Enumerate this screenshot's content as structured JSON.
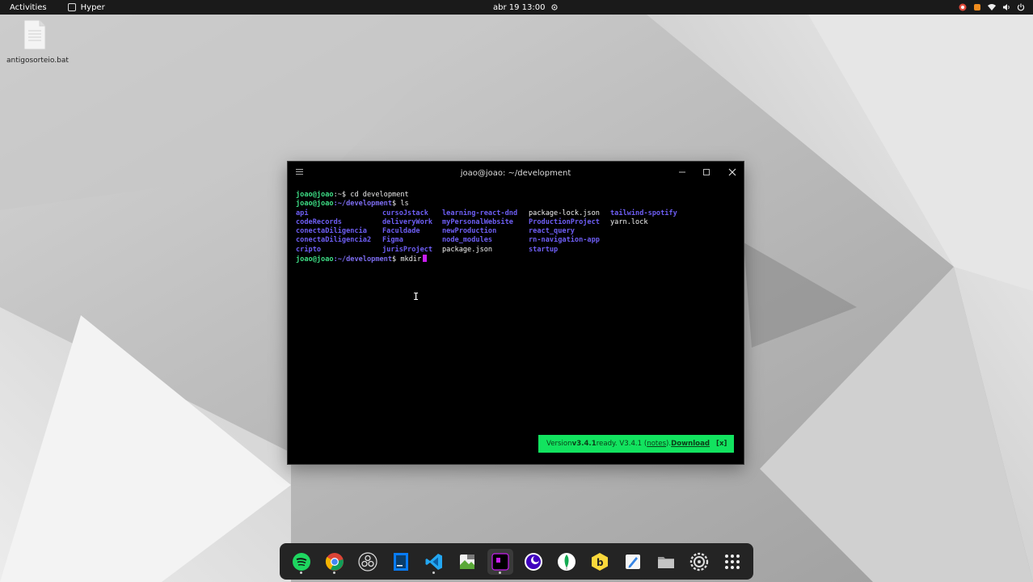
{
  "topbar": {
    "activities": "Activities",
    "app_name": "Hyper",
    "clock": "abr 19  13:00"
  },
  "desktop": {
    "file_name": "antigosorteio.bat"
  },
  "terminal": {
    "title": "joao@joao: ~/development",
    "prompt1_user": "joao@joao",
    "prompt1_path": ":~$",
    "cmd1": " cd development",
    "prompt2_user": "joao@joao",
    "prompt2_path": ":~/development",
    "prompt2_symbol": "$",
    "cmd2": " ls",
    "listing": [
      {
        "name": "api",
        "type": "dir"
      },
      {
        "name": "cursoJstack",
        "type": "dir"
      },
      {
        "name": "learning-react-dnd",
        "type": "dir"
      },
      {
        "name": "package-lock.json",
        "type": "file"
      },
      {
        "name": "tailwind-spotify",
        "type": "dir"
      },
      {
        "name": "codeRecords",
        "type": "dir"
      },
      {
        "name": "deliveryWork",
        "type": "dir"
      },
      {
        "name": "myPersonalWebsite",
        "type": "dir"
      },
      {
        "name": "ProductionProject",
        "type": "dir"
      },
      {
        "name": "yarn.lock",
        "type": "file"
      },
      {
        "name": "conectaDiligencia",
        "type": "dir"
      },
      {
        "name": "Faculdade",
        "type": "dir"
      },
      {
        "name": "newProduction",
        "type": "dir"
      },
      {
        "name": "react_query",
        "type": "dir"
      },
      {
        "name": "",
        "type": "file"
      },
      {
        "name": "conectaDiligencia2",
        "type": "dir"
      },
      {
        "name": "Figma",
        "type": "dir"
      },
      {
        "name": "node_modules",
        "type": "dir"
      },
      {
        "name": "rn-navigation-app",
        "type": "dir"
      },
      {
        "name": "",
        "type": "file"
      },
      {
        "name": "cripto",
        "type": "dir"
      },
      {
        "name": "jurisProject",
        "type": "dir"
      },
      {
        "name": "package.json",
        "type": "file"
      },
      {
        "name": "startup",
        "type": "dir"
      },
      {
        "name": "",
        "type": "file"
      }
    ],
    "prompt3_user": "joao@joao",
    "prompt3_path": ":~/development",
    "prompt3_symbol": "$",
    "cmd3": " mkdir",
    "update": {
      "prefix": "Version ",
      "version": "v3.4.1",
      "ready": " ready. V3.4.1 (",
      "notes": "notes",
      "after_notes": "). ",
      "download": "Download",
      "close": "[x]"
    }
  },
  "dock": {
    "apps": [
      "spotify-icon",
      "chrome-icon",
      "obs-icon",
      "jetbrains-icon",
      "vscode-icon",
      "gedit-icon",
      "hyper-terminal-icon",
      "insomnia-icon",
      "mongodb-compass-icon",
      "beekeeper-icon",
      "text-editor-icon",
      "files-icon",
      "settings-icon",
      "app-grid-icon"
    ]
  },
  "colors": {
    "prompt_green": "#3ddc84",
    "dir_purple": "#6e5ef5",
    "cursor_magenta": "#c81ef0",
    "update_green": "#12e35f"
  }
}
